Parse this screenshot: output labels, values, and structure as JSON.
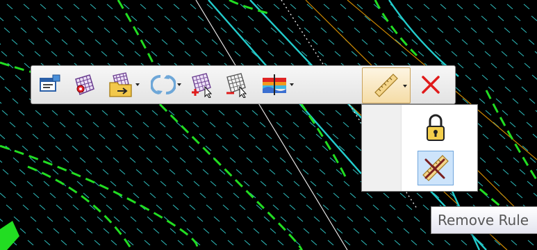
{
  "toolbar": {
    "buttons": [
      {
        "name": "properties-button",
        "icon": "properties-icon"
      },
      {
        "name": "mesh-select-button",
        "icon": "mesh-select-icon"
      },
      {
        "name": "mesh-import-button",
        "icon": "mesh-folder-icon",
        "has_dropdown": true
      },
      {
        "name": "refresh-button",
        "icon": "refresh-icon",
        "has_dropdown": true
      },
      {
        "name": "add-to-mesh-button",
        "icon": "mesh-add-icon"
      },
      {
        "name": "remove-from-mesh-button",
        "icon": "mesh-remove-icon"
      },
      {
        "name": "profile-button",
        "icon": "profile-icon",
        "has_dropdown": true
      },
      {
        "name": "rule-button",
        "icon": "ruler-icon",
        "has_dropdown": true,
        "active": true
      },
      {
        "name": "close-button",
        "icon": "close-icon"
      }
    ]
  },
  "dropdown": {
    "items": [
      {
        "name": "lock-rule-item",
        "icon": "lock-icon"
      },
      {
        "name": "remove-rule-item",
        "icon": "remove-ruler-icon",
        "hovered": true
      }
    ]
  },
  "tooltip": {
    "text": "Remove Rule"
  },
  "colors": {
    "background": "#000000",
    "hatch": "#33cccc",
    "contour_green": "#22dd22",
    "road_cyan": "#22cccc",
    "road_orange": "#cc8800"
  }
}
